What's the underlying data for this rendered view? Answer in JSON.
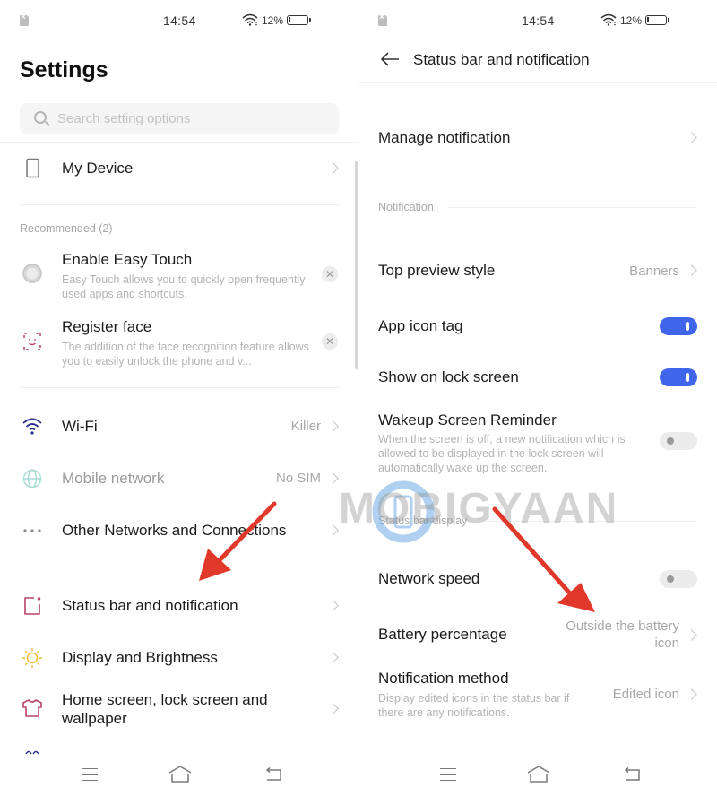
{
  "status_bar": {
    "time": "14:54",
    "battery_percent": "12%",
    "icons": [
      "no-sim-icon",
      "wifi-icon",
      "battery-icon"
    ]
  },
  "left": {
    "title": "Settings",
    "search": {
      "placeholder": "Search setting options",
      "value": ""
    },
    "my_device": {
      "label": "My Device",
      "icon": "phone-icon"
    },
    "recommended": {
      "header": "Recommended (2)",
      "items": [
        {
          "title": "Enable Easy Touch",
          "description": "Easy Touch allows you to quickly open frequently used apps and shortcuts.",
          "icon": "easy-touch-icon"
        },
        {
          "title": "Register face",
          "description": "The addition of the face recognition feature allows you to easily unlock the phone and v...",
          "icon": "face-scan-icon"
        }
      ]
    },
    "items": [
      {
        "label": "Wi-Fi",
        "value": "Killer",
        "icon": "wifi-icon",
        "disabled": false
      },
      {
        "label": "Mobile network",
        "value": "No SIM",
        "icon": "globe-icon",
        "disabled": true
      },
      {
        "label": "Other Networks and Connections",
        "value": "",
        "icon": "more-dots-icon",
        "disabled": false
      },
      {
        "label": "Status bar and notification",
        "value": "",
        "icon": "status-bar-icon",
        "disabled": false
      },
      {
        "label": "Display and Brightness",
        "value": "",
        "icon": "sun-icon",
        "disabled": false
      },
      {
        "label": "Home screen, lock screen and wallpaper",
        "value": "",
        "icon": "shirt-icon",
        "disabled": false
      }
    ]
  },
  "right": {
    "title": "Status bar and notification",
    "manage_notification": "Manage notification",
    "sections": {
      "notification": "Notification",
      "status_bar_display": "Status bar display"
    },
    "top_preview_style": {
      "label": "Top preview style",
      "value": "Banners"
    },
    "app_icon_tag": {
      "label": "App icon tag",
      "enabled": true
    },
    "show_on_lock_screen": {
      "label": "Show on lock screen",
      "enabled": true
    },
    "wakeup_screen_reminder": {
      "label": "Wakeup Screen Reminder",
      "description": "When the screen is off, a new notification which is allowed to be displayed in the lock screen will automatically wake up the screen.",
      "enabled": false
    },
    "network_speed": {
      "label": "Network speed",
      "enabled": false
    },
    "battery_percentage": {
      "label": "Battery percentage",
      "value": "Outside the battery icon"
    },
    "notification_method": {
      "label": "Notification method",
      "description": "Display edited icons in the status bar if there are any notifications.",
      "value": "Edited icon"
    }
  },
  "navbar": {
    "buttons": [
      "menu-icon",
      "home-icon",
      "back-icon"
    ]
  },
  "overlay": {
    "watermark": "MOBIGYAAN",
    "arrow_color": "#e0392b"
  },
  "colors": {
    "toggle_on": "#3f66ea",
    "toggle_off": "#ececec",
    "accent_pink": "#b8436b",
    "wifi_blue": "#2c2f8f",
    "sun_yellow": "#f0b93a"
  }
}
